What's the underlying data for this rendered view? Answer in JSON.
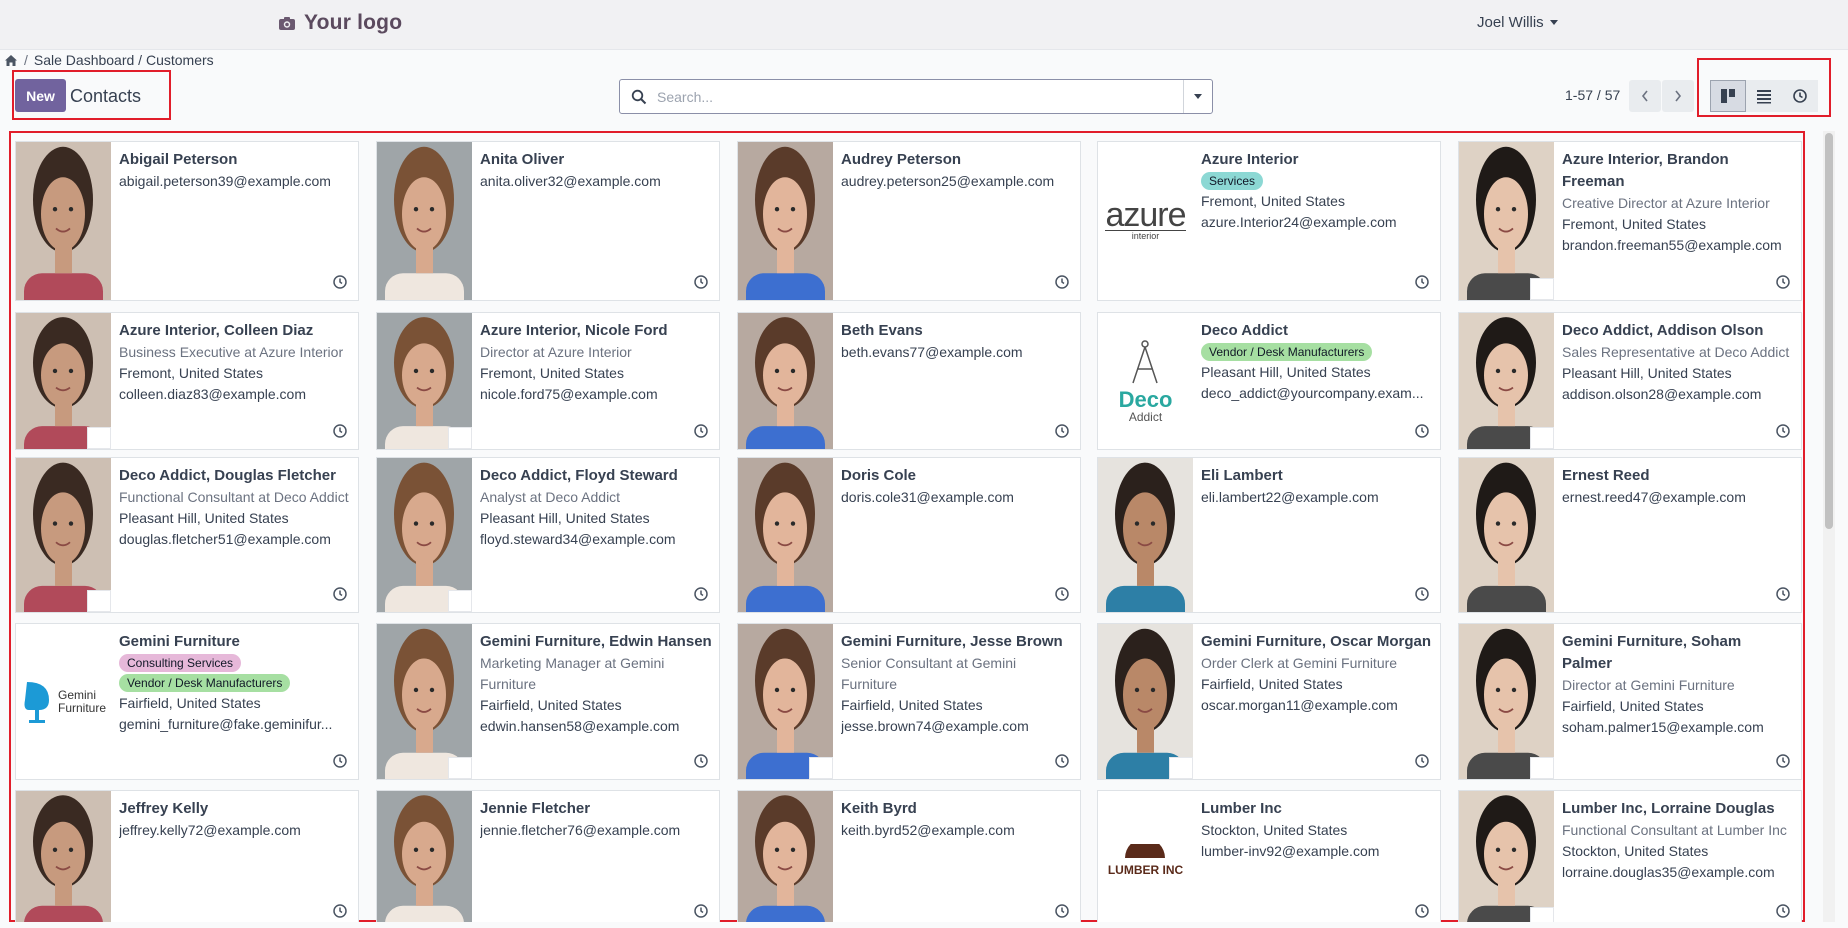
{
  "navbar": {
    "logo_text": "Your logo",
    "user_name": "Joel Willis"
  },
  "breadcrumb": {
    "separator": "/",
    "path": "Sale Dashboard / Customers"
  },
  "control": {
    "new_label": "New",
    "title": "Contacts",
    "search_placeholder": "Search...",
    "pager": "1-57 / 57"
  },
  "view_switcher": [
    {
      "icon": "kanban-view-icon",
      "active": true
    },
    {
      "icon": "list-view-icon",
      "active": false
    },
    {
      "icon": "activity-view-icon",
      "active": false
    }
  ],
  "colors": {
    "accent": "#71639e",
    "highlight": "#e11d2a",
    "tag_services": "#8cd8d4",
    "tag_vendor": "#a6dfa2",
    "tag_consulting": "#e6b8d9"
  },
  "cards": [
    {
      "name": "Abigail Peterson",
      "lines": [
        "abigail.peterson39@example.com"
      ],
      "photo": "person"
    },
    {
      "name": "Anita Oliver",
      "lines": [
        "anita.oliver32@example.com"
      ],
      "photo": "person"
    },
    {
      "name": "Audrey Peterson",
      "lines": [
        "audrey.peterson25@example.com"
      ],
      "photo": "person"
    },
    {
      "name": "Azure Interior",
      "tags": [
        "Services"
      ],
      "lines": [
        "Fremont, United States",
        "azure.Interior24@example.com"
      ],
      "photo": "azure-logo"
    },
    {
      "name": "Azure Interior, Brandon Freeman",
      "func": "Creative Director at Azure Interior",
      "lines": [
        "Fremont, United States",
        "brandon.freeman55@example.com"
      ],
      "photo": "person",
      "mini": "azure"
    },
    {
      "name": "Azure Interior, Colleen Diaz",
      "func": "Business Executive at Azure Interior",
      "lines": [
        "Fremont, United States",
        "colleen.diaz83@example.com"
      ],
      "photo": "person",
      "mini": "azure"
    },
    {
      "name": "Azure Interior, Nicole Ford",
      "func": "Director at Azure Interior",
      "lines": [
        "Fremont, United States",
        "nicole.ford75@example.com"
      ],
      "photo": "person",
      "mini": "azure"
    },
    {
      "name": "Beth Evans",
      "lines": [
        "beth.evans77@example.com"
      ],
      "photo": "person"
    },
    {
      "name": "Deco Addict",
      "tags": [
        "Vendor / Desk Manufacturers"
      ],
      "lines": [
        "Pleasant Hill, United States",
        "deco_addict@yourcompany.exam..."
      ],
      "photo": "deco-logo"
    },
    {
      "name": "Deco Addict, Addison Olson",
      "func": "Sales Representative at Deco Addict",
      "lines": [
        "Pleasant Hill, United States",
        "addison.olson28@example.com"
      ],
      "photo": "person",
      "mini": "deco"
    },
    {
      "name": "Deco Addict, Douglas Fletcher",
      "func": "Functional Consultant at Deco Addict",
      "lines": [
        "Pleasant Hill, United States",
        "douglas.fletcher51@example.com"
      ],
      "photo": "person",
      "mini": "deco"
    },
    {
      "name": "Deco Addict, Floyd Steward",
      "func": "Analyst at Deco Addict",
      "lines": [
        "Pleasant Hill, United States",
        "floyd.steward34@example.com"
      ],
      "photo": "person",
      "mini": "deco"
    },
    {
      "name": "Doris Cole",
      "lines": [
        "doris.cole31@example.com"
      ],
      "photo": "person"
    },
    {
      "name": "Eli Lambert",
      "lines": [
        "eli.lambert22@example.com"
      ],
      "photo": "person"
    },
    {
      "name": "Ernest Reed",
      "lines": [
        "ernest.reed47@example.com"
      ],
      "photo": "person"
    },
    {
      "name": "Gemini Furniture",
      "tags": [
        "Consulting Services",
        "Vendor / Desk Manufacturers"
      ],
      "lines": [
        "Fairfield, United States",
        "gemini_furniture@fake.geminifur..."
      ],
      "photo": "gemini-logo"
    },
    {
      "name": "Gemini Furniture, Edwin Hansen",
      "func": "Marketing Manager at Gemini Furniture",
      "lines": [
        "Fairfield, United States",
        "edwin.hansen58@example.com"
      ],
      "photo": "person",
      "mini": "gemini"
    },
    {
      "name": "Gemini Furniture, Jesse Brown",
      "func": "Senior Consultant at Gemini Furniture",
      "lines": [
        "Fairfield, United States",
        "jesse.brown74@example.com"
      ],
      "photo": "person",
      "mini": "gemini"
    },
    {
      "name": "Gemini Furniture, Oscar Morgan",
      "func": "Order Clerk at Gemini Furniture",
      "lines": [
        "Fairfield, United States",
        "oscar.morgan11@example.com"
      ],
      "photo": "person",
      "mini": "gemini"
    },
    {
      "name": "Gemini Furniture, Soham Palmer",
      "func": "Director at Gemini Furniture",
      "lines": [
        "Fairfield, United States",
        "soham.palmer15@example.com"
      ],
      "photo": "person",
      "mini": "gemini"
    },
    {
      "name": "Jeffrey Kelly",
      "lines": [
        "jeffrey.kelly72@example.com"
      ],
      "photo": "person"
    },
    {
      "name": "Jennie Fletcher",
      "lines": [
        "jennie.fletcher76@example.com"
      ],
      "photo": "person"
    },
    {
      "name": "Keith Byrd",
      "lines": [
        "keith.byrd52@example.com"
      ],
      "photo": "person"
    },
    {
      "name": "Lumber Inc",
      "lines": [
        "Stockton, United States",
        "lumber-inv92@example.com"
      ],
      "photo": "lumber-logo"
    },
    {
      "name": "Lumber Inc, Lorraine Douglas",
      "func": "Functional Consultant at Lumber Inc",
      "lines": [
        "Stockton, United States",
        "lorraine.douglas35@example.com"
      ],
      "photo": "person",
      "mini": "lumber"
    }
  ],
  "logos": {
    "azure_text": "azure",
    "azure_sub": "interior",
    "deco_text": "Deco",
    "deco_sub": "Addict",
    "gemini_text": "Gemini",
    "gemini_sub": "Furniture",
    "lumber_text": "LUMBER INC"
  }
}
